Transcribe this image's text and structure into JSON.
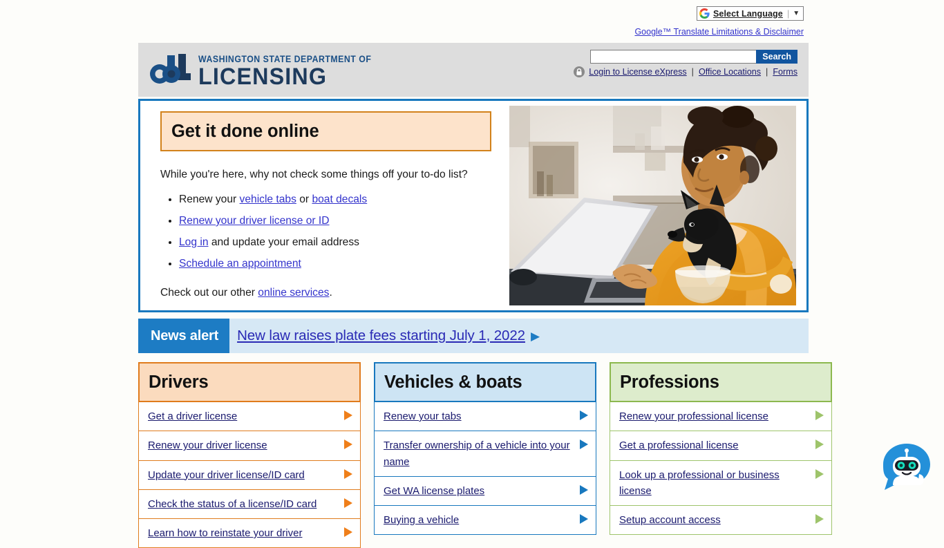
{
  "translate": {
    "widget_label": "Select Language",
    "caret": "▼",
    "separator": "|",
    "disclaimer": "Google™ Translate Limitations & Disclaimer",
    "google_icon": "google-g-icon"
  },
  "header": {
    "logo_line1": "WASHINGTON STATE DEPARTMENT OF",
    "logo_line2": "LICENSING",
    "search": {
      "value": "",
      "placeholder": "",
      "button_label": "Search"
    },
    "links": [
      {
        "label": "Login to License eXpress",
        "icon": "lock-icon"
      },
      {
        "label": "Office Locations"
      },
      {
        "label": "Forms"
      }
    ],
    "link_separator": "|"
  },
  "hero": {
    "banner_title": "Get it done online",
    "intro": "While you're here, why not check some things off your to-do list?",
    "list": [
      {
        "prefix": "Renew your ",
        "link1": "vehicle tabs",
        "mid": " or ",
        "link2": "boat decals",
        "suffix": ""
      },
      {
        "prefix": "",
        "link1": "Renew your driver license or ID",
        "mid": "",
        "link2": "",
        "suffix": ""
      },
      {
        "prefix": "",
        "link1": "Log in",
        "mid": "",
        "link2": "",
        "suffix": " and update your email address"
      },
      {
        "prefix": "",
        "link1": "Schedule an appointment",
        "mid": "",
        "link2": "",
        "suffix": ""
      }
    ],
    "outro_prefix": "Check out our other ",
    "outro_link": "online services",
    "outro_suffix": ".",
    "photo_alt": "Woman with small dog working on a laptop at a table"
  },
  "news_alert": {
    "label": "News alert",
    "headline": "New law raises plate fees starting July 1, 2022",
    "arrow": "▶"
  },
  "cards": [
    {
      "id": "drivers",
      "title": "Drivers",
      "accent": "#e07b1c",
      "head_bg": "#fbdbbe",
      "items": [
        "Get a driver license",
        "Renew your driver license",
        "Update your driver license/ID card",
        "Check the status of a license/ID card",
        "Learn how to reinstate your driver"
      ]
    },
    {
      "id": "vehicles",
      "title": "Vehicles & boats",
      "accent": "#1878be",
      "head_bg": "#cde4f4",
      "items": [
        "Renew your tabs",
        "Transfer ownership of a vehicle into your name",
        "Get WA license plates",
        "Buying a vehicle"
      ]
    },
    {
      "id": "professions",
      "title": "Professions",
      "accent": "#9ec46b",
      "head_bg": "#ddeccc",
      "items": [
        "Renew your professional license",
        "Get a professional license",
        "Look up a professional or business license",
        "Setup account access"
      ]
    }
  ],
  "chatbot": {
    "name": "chat-bot-launcher",
    "tooltip": "Chat with us"
  },
  "colors": {
    "brand_blue": "#1878be",
    "logo_navy": "#1d3a5c",
    "search_button": "#11559f",
    "news_alert_bg": "#d6e8f5",
    "news_alert_label_bg": "#1d7cc4",
    "header_bg": "#dddddd",
    "link": "#1a1a6e",
    "page_bg": "#fdfdfa"
  }
}
